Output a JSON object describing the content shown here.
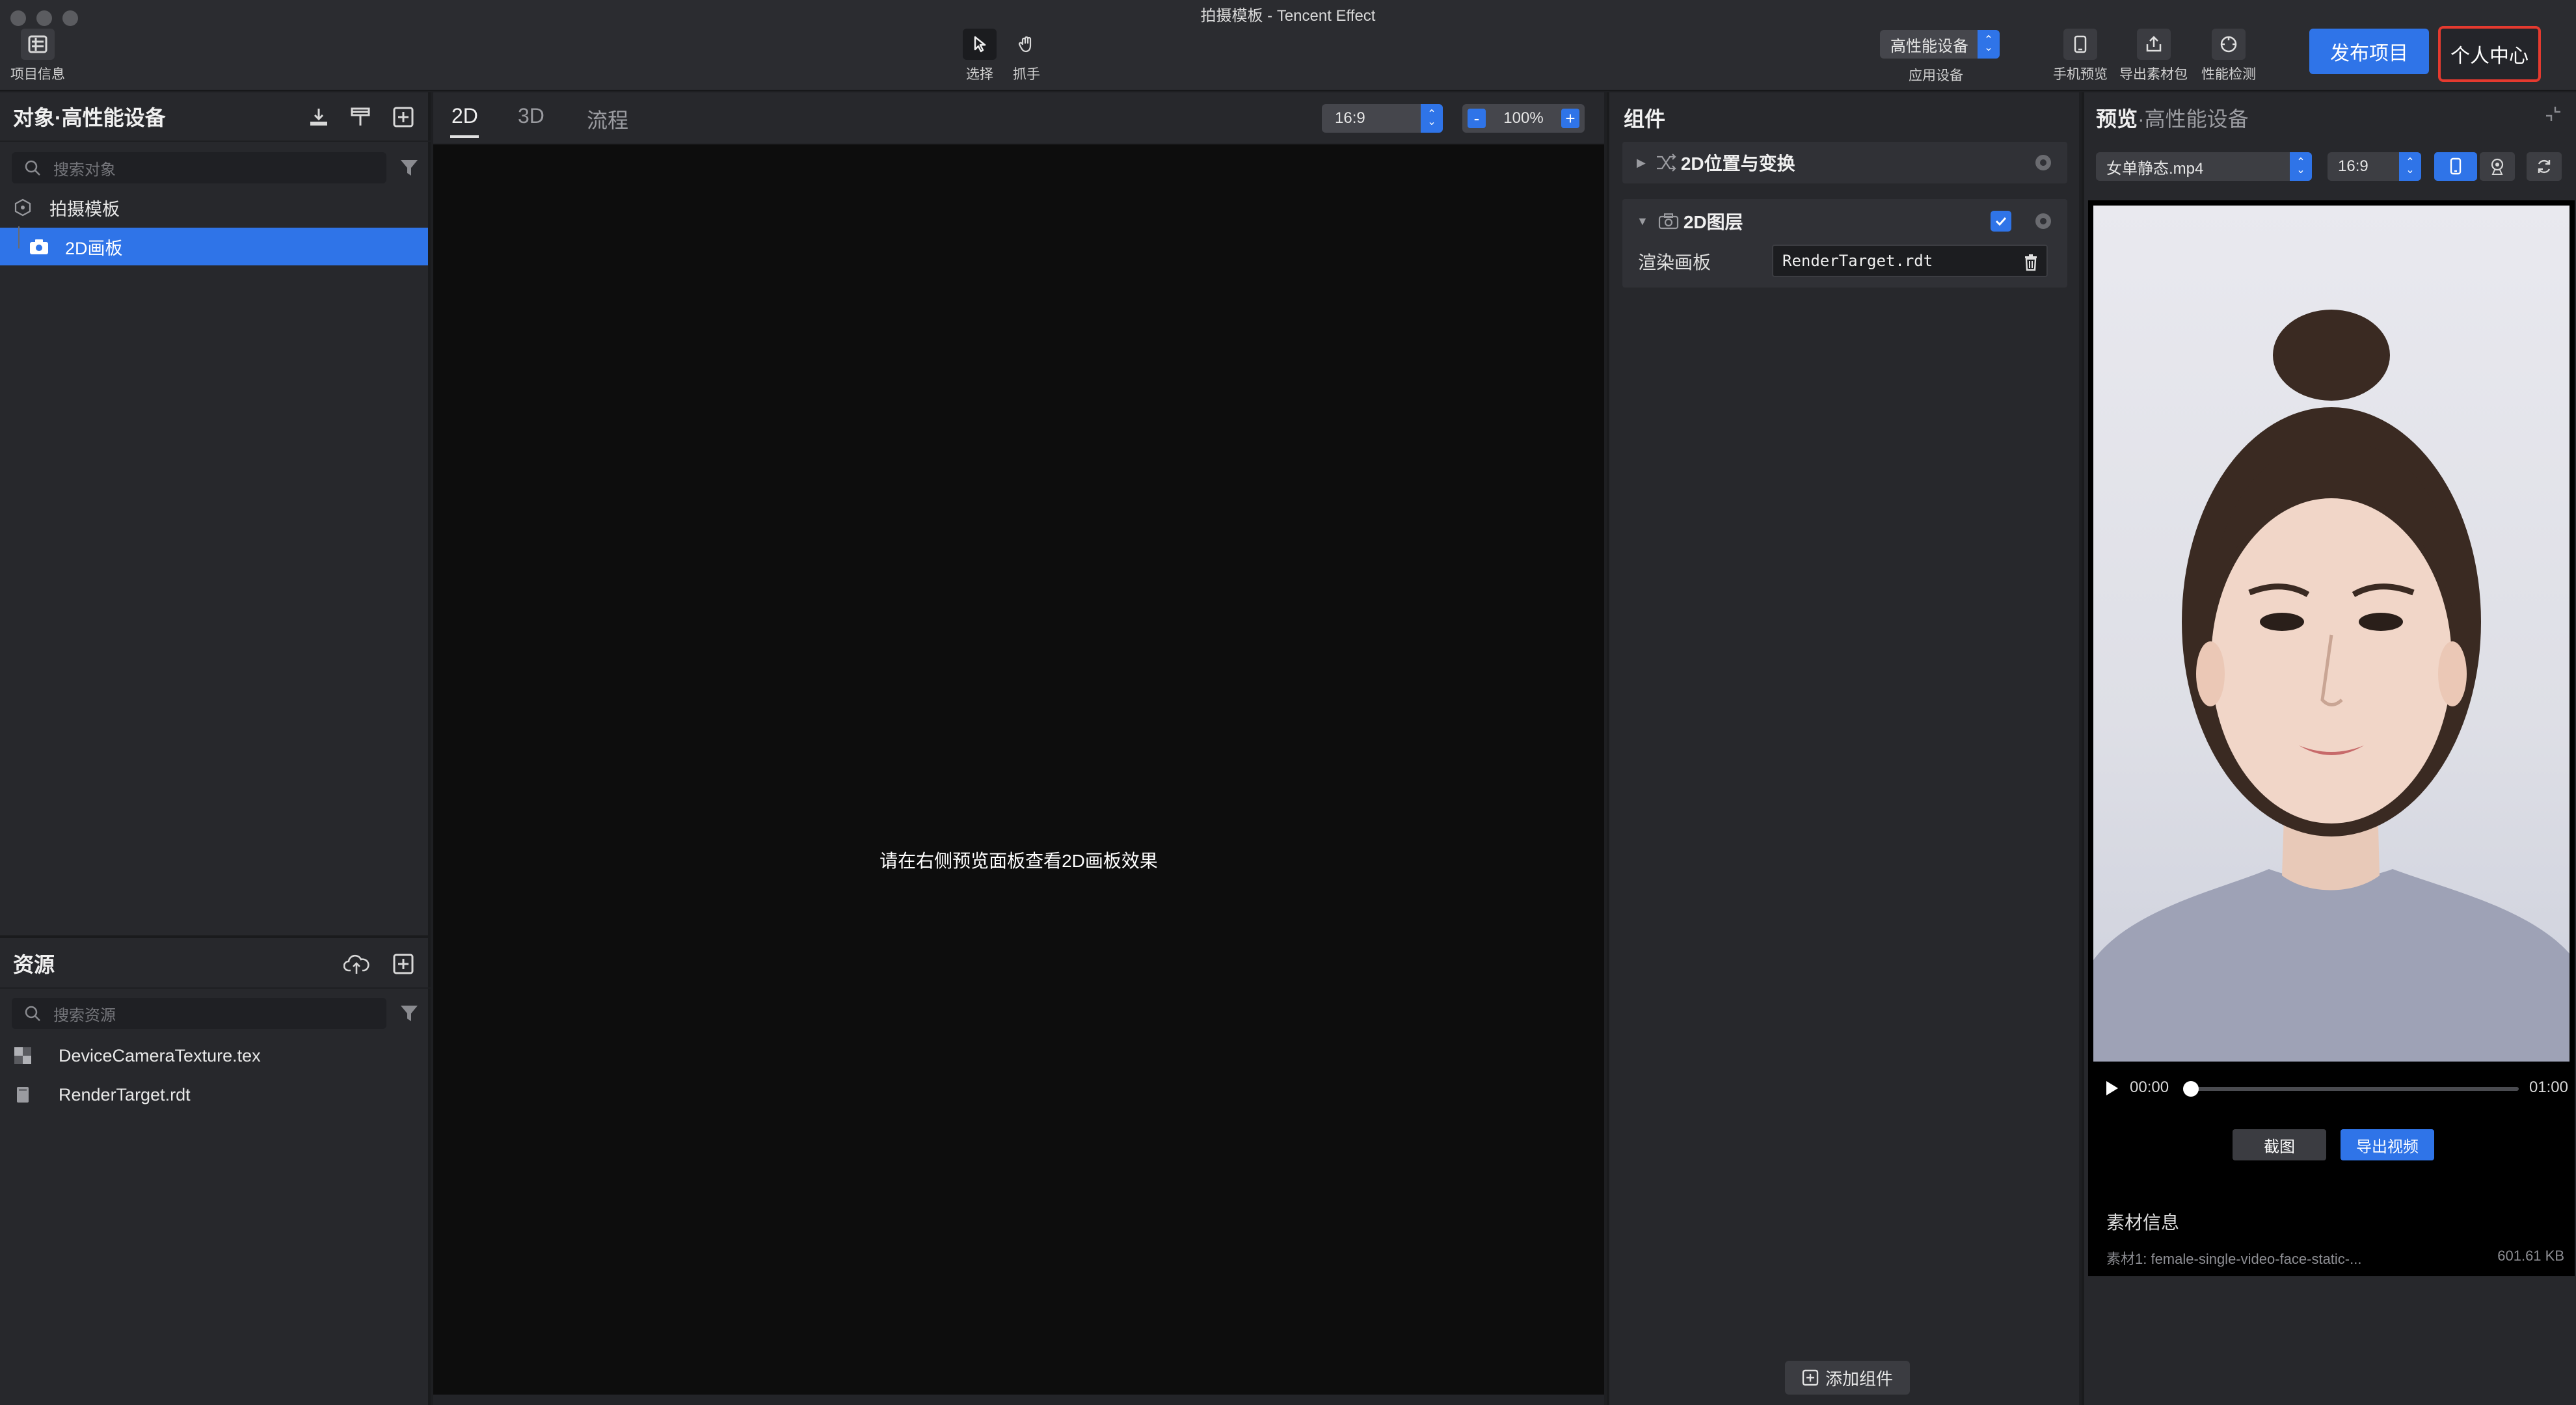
{
  "window": {
    "title": "拍摄模板 - Tencent Effect"
  },
  "toolbar": {
    "project_info_label": "项目信息",
    "select_label": "选择",
    "hand_label": "抓手",
    "device_select_value": "高性能设备",
    "device_select_caption": "应用设备",
    "phone_preview_label": "手机预览",
    "export_pack_label": "导出素材包",
    "perf_check_label": "性能检测",
    "publish_label": "发布项目",
    "personal_center_label": "个人中心"
  },
  "objects_panel": {
    "title": "对象·高性能设备",
    "search_placeholder": "搜索对象",
    "tree": [
      {
        "label": "拍摄模板",
        "selected": false
      },
      {
        "label": "2D画板",
        "selected": true
      }
    ]
  },
  "assets_panel": {
    "title": "资源",
    "search_placeholder": "搜索资源",
    "items": [
      {
        "label": "DeviceCameraTexture.tex",
        "icon": "texture-icon"
      },
      {
        "label": "RenderTarget.rdt",
        "icon": "render-target-icon"
      }
    ]
  },
  "editor": {
    "tabs": [
      {
        "label": "2D",
        "active": true
      },
      {
        "label": "3D",
        "active": false
      },
      {
        "label": "流程",
        "active": false
      }
    ],
    "aspect_ratio": "16:9",
    "zoom": "100%",
    "zoom_out": "-",
    "zoom_in": "+",
    "canvas_message": "请在右侧预览面板查看2D画板效果"
  },
  "components_panel": {
    "title": "组件",
    "cards": [
      {
        "title": "2D位置与变换",
        "expanded": false
      },
      {
        "title": "2D图层",
        "expanded": true,
        "enabled": true,
        "field_label": "渲染画板",
        "field_value": "RenderTarget.rdt"
      }
    ],
    "add_component_label": "添加组件"
  },
  "preview_panel": {
    "title": "预览",
    "subtitle": "·高性能设备",
    "media_select": "女单静态.mp4",
    "aspect_ratio": "16:9",
    "time_current": "00:00",
    "time_total": "01:00",
    "progress": 0,
    "screenshot_label": "截图",
    "export_video_label": "导出视频",
    "material_title": "素材信息",
    "material_line": "素材1:  female-single-video-face-static-...",
    "material_size": "601.61 KB"
  },
  "colors": {
    "accent": "#2f74e8",
    "highlight_border": "#e53a2f",
    "panel": "#27282c",
    "canvas": "#0d0d0d"
  }
}
